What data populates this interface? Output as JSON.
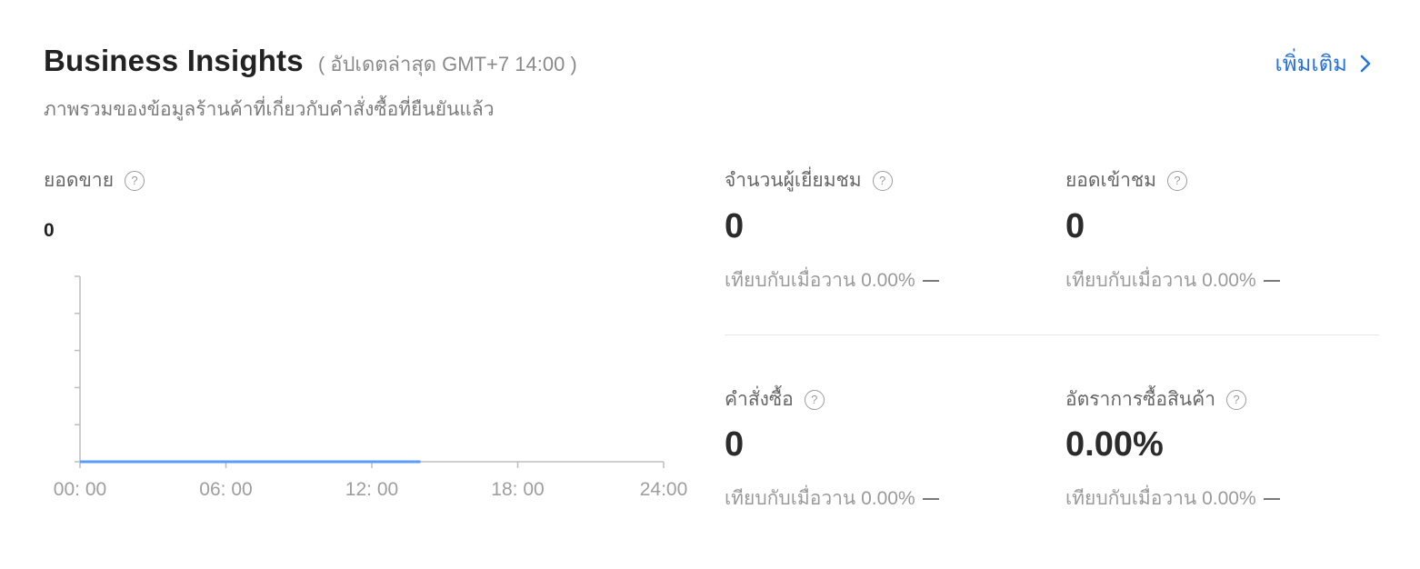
{
  "header": {
    "title": "Business Insights",
    "updated": "( อัปเดตล่าสุด GMT+7 14:00 )",
    "subtitle": "ภาพรวมของข้อมูลร้านค้าที่เกี่ยวกับคำสั่งซื้อที่ยืนยันแล้ว",
    "more_label": "เพิ่มเติม",
    "accent_color": "#2673dd"
  },
  "help_icon_glyph": "?",
  "sales": {
    "label": "ยอดขาย",
    "value": "0"
  },
  "metrics": [
    {
      "label": "จำนวนผู้เยี่ยมชม",
      "value": "0",
      "compare": "เทียบกับเมื่อวาน 0.00%"
    },
    {
      "label": "ยอดเข้าชม",
      "value": "0",
      "compare": "เทียบกับเมื่อวาน 0.00%"
    },
    {
      "label": "คำสั่งซื้อ",
      "value": "0",
      "compare": "เทียบกับเมื่อวาน 0.00%"
    },
    {
      "label": "อัตราการซื้อสินค้า",
      "value": "0.00%",
      "compare": "เทียบกับเมื่อวาน 0.00%"
    }
  ],
  "chart_data": {
    "type": "line",
    "x": [
      "00:00",
      "14:00"
    ],
    "series": [
      {
        "values": [
          0,
          0
        ],
        "color": "#5b9cf6"
      }
    ],
    "xticks": [
      "00: 00",
      "06: 00",
      "12: 00",
      "18: 00",
      "24:00"
    ],
    "xlim": [
      "00:00",
      "24:00"
    ],
    "yticks_count": 6,
    "grid": false,
    "title": "",
    "xlabel": "",
    "ylabel": ""
  }
}
